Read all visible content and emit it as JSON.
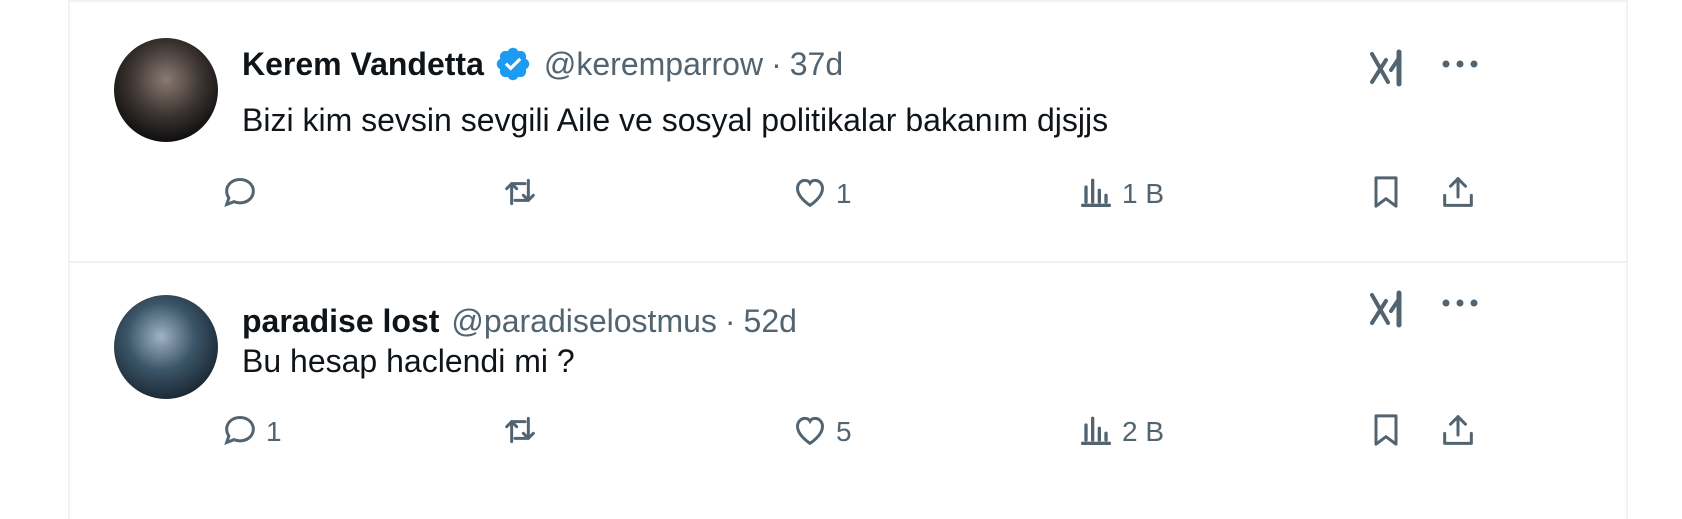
{
  "tweets": [
    {
      "name": "Kerem Vandetta",
      "verified": true,
      "handle": "@keremparrow",
      "separator": "·",
      "time": "37d",
      "text": "Bizi kim sevsin sevgili Aile ve sosyal politikalar bakanım djsjjs",
      "replies": "",
      "retweets": "",
      "likes": "1",
      "views": "1 B"
    },
    {
      "name": "paradise lost",
      "verified": false,
      "handle": "@paradiselostmus",
      "separator": "·",
      "time": "52d",
      "text": "Bu hesap haclendi mi ?",
      "replies": "1",
      "retweets": "",
      "likes": "5",
      "views": "2 B"
    }
  ],
  "colors": {
    "text": "#0f1419",
    "secondary": "#536471",
    "verified": "#1d9bf0",
    "divider": "#eff3f4"
  }
}
